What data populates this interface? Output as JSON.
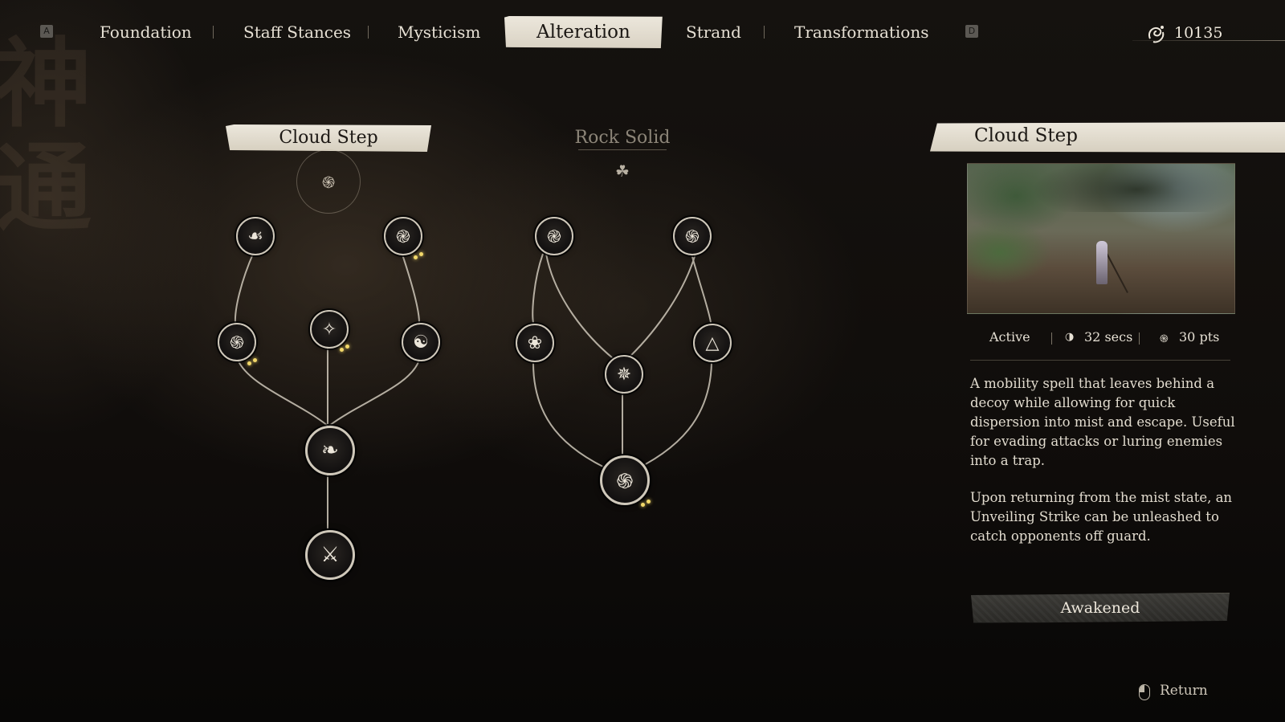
{
  "nav": {
    "key_left": "A",
    "key_right": "D",
    "tabs": [
      {
        "label": "Foundation",
        "active": false
      },
      {
        "label": "Staff Stances",
        "active": false
      },
      {
        "label": "Mysticism",
        "active": false
      },
      {
        "label": "Alteration",
        "active": true
      },
      {
        "label": "Strand",
        "active": false
      },
      {
        "label": "Transformations",
        "active": false
      }
    ],
    "currency_value": "10135",
    "currency_icon": "spirit-swirl-icon"
  },
  "trees": [
    {
      "name": "Cloud Step",
      "selected": true,
      "root_icon": "cloud-swirl-icon"
    },
    {
      "name": "Rock Solid",
      "selected": false,
      "root_icon": "triple-knot-icon"
    }
  ],
  "detail": {
    "title": "Cloud Step",
    "type": "Active",
    "cooldown": "32 secs",
    "cooldown_icon": "moon-timer-icon",
    "cost": "30 pts",
    "cost_icon": "mana-swirl-icon",
    "description_1": "A mobility spell that leaves behind a decoy while allowing for quick dispersion into mist and escape. Useful for evading attacks or luring enemies into a trap.",
    "description_2": "Upon returning from the mist state, an Unveiling Strike can be unleashed to catch opponents off guard.",
    "action_label": "Awakened"
  },
  "footer": {
    "return_label": "Return",
    "return_icon": "mouse-icon"
  },
  "colors": {
    "background": "#0d0b09",
    "banner": "#ece7dc",
    "text": "#e8e2d6",
    "progress_dot": "#f2d86a"
  }
}
